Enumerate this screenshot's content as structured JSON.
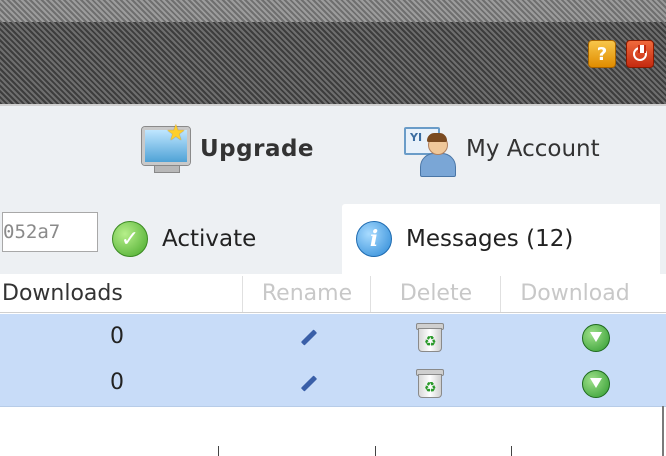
{
  "header": {
    "help_icon_label": "?",
    "colors": {
      "help": "#f0a21c",
      "power": "#e24a22",
      "header_bg": "#5a5a5a"
    }
  },
  "toolbar": {
    "upgrade_label": "Upgrade",
    "account_label": "My Account",
    "account_card_text": "YI"
  },
  "tabs": {
    "id_value": "052a7",
    "activate_label": "Activate",
    "messages_label": "Messages (12)"
  },
  "table": {
    "columns": [
      "Downloads",
      "Rename",
      "Delete",
      "Download"
    ],
    "rows": [
      {
        "downloads": "0"
      },
      {
        "downloads": "0"
      }
    ],
    "icons": {
      "rename": "pencil-icon",
      "delete": "recycle-bin-icon",
      "download": "download-arrow-icon"
    }
  }
}
